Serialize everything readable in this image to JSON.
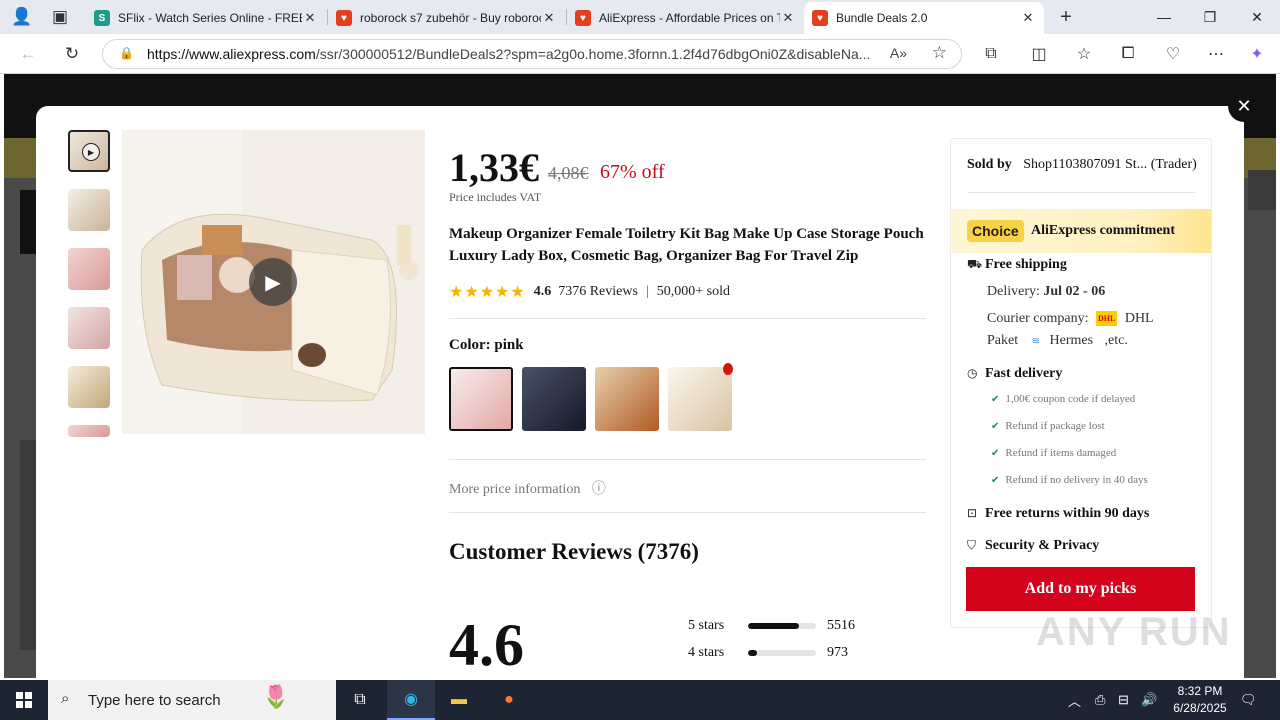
{
  "browser": {
    "tabs": [
      {
        "title": "SFlix - Watch Series Online - FREE",
        "favicon_color": "#1f9b8e"
      },
      {
        "title": "roborock s7 zubehör - Buy roborock",
        "favicon_color": "#e43d1f"
      },
      {
        "title": "AliExpress - Affordable Prices on To",
        "favicon_color": "#e43d1f"
      },
      {
        "title": "Bundle Deals 2.0",
        "favicon_color": "#e43d1f"
      }
    ],
    "url_host": "https://www.aliexpress.com",
    "url_path": "/ssr/300000512/BundleDeals2?spm=a2g0o.home.3fornn.1.2f4d76dbgOni0Z&disableNa..."
  },
  "product": {
    "price": "1,33€",
    "old_price": "4,08€",
    "discount": "67% off",
    "vat_note": "Price includes VAT",
    "title": "Makeup Organizer Female Toiletry Kit Bag Make Up Case Storage Pouch Luxury Lady Box, Cosmetic Bag, Organizer Bag For Travel Zip",
    "rating": "4.6",
    "rating_value": 4.6,
    "reviews": "7376 Reviews",
    "sold": "50,000+ sold",
    "color_label": "Color: pink",
    "swatches": [
      {
        "name": "pink",
        "color": "#e8bcb8"
      },
      {
        "name": "navy",
        "color": "#1e2436"
      },
      {
        "name": "brown",
        "color": "#b4622c"
      },
      {
        "name": "beige",
        "color": "#efe3cf"
      }
    ],
    "more_price": "More price information"
  },
  "reviews": {
    "heading": "Customer Reviews (7376)",
    "average": "4.6",
    "breakdown": [
      {
        "label": "5 stars",
        "count": "5516",
        "fraction": 0.75
      },
      {
        "label": "4 stars",
        "count": "973",
        "fraction": 0.13
      }
    ]
  },
  "side": {
    "sold_by_label": "Sold by",
    "seller": "Shop1103807091 St... (Trader)",
    "choice_badge": "Choice",
    "choice_text": "AliExpress commitment",
    "free_shipping": "Free shipping",
    "delivery_label": "Delivery:",
    "delivery_dates": "Jul 02 - 06",
    "courier_label": "Courier company:",
    "courier_dhl": "DHL",
    "courier_line2a": "Paket",
    "courier_hermes": "Hermes",
    "courier_etc": ",etc.",
    "fast_delivery": "Fast delivery",
    "fast_items": [
      "1,00€ coupon code if delayed",
      "Refund if package lost",
      "Refund if items damaged",
      "Refund if no delivery in 40 days"
    ],
    "free_returns": "Free returns within 90 days",
    "security": "Security & Privacy",
    "add_button": "Add to my picks"
  },
  "taskbar": {
    "search_placeholder": "Type here to search",
    "time": "8:32 PM",
    "date": "6/28/2025"
  },
  "watermark": "ANY RUN"
}
